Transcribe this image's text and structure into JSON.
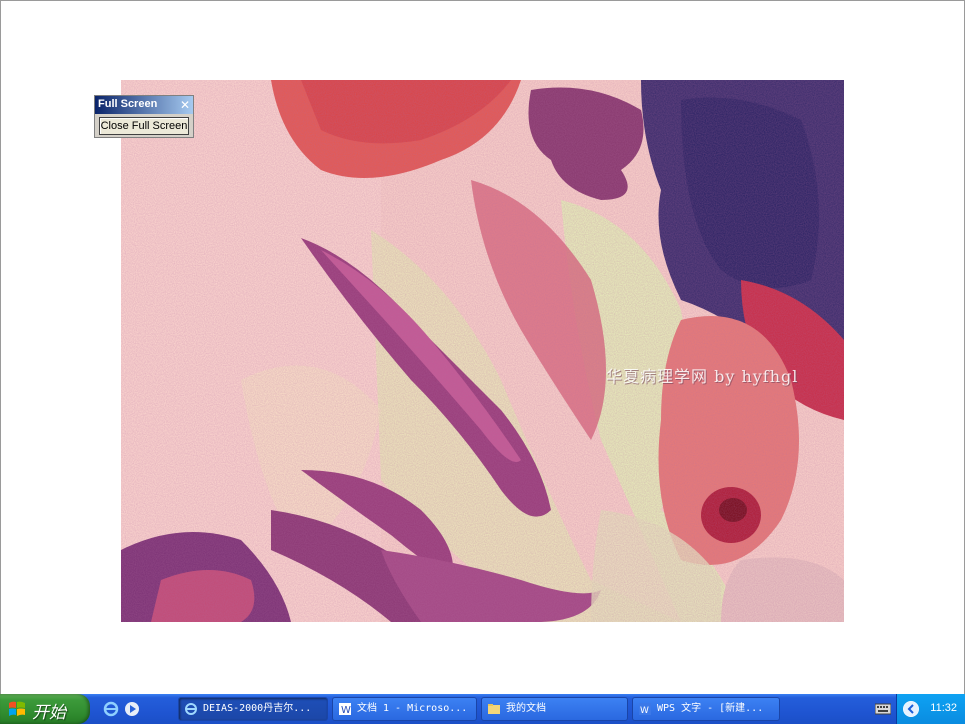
{
  "window": {
    "watermark": "华夏病理学网 by hyfhgl"
  },
  "fullscreen_toolbar": {
    "title": "Full Screen",
    "close_glyph": "✕",
    "button_label": "Close Full Screen"
  },
  "taskbar": {
    "start_label": "开始",
    "quick_launch": [
      {
        "icon": "ie-icon"
      },
      {
        "icon": "media-player-icon"
      }
    ],
    "buttons": [
      {
        "label": "DEIAS-2000丹吉尔...",
        "icon": "ie-window-icon",
        "active": true
      },
      {
        "label": "文档 1 - Microso...",
        "icon": "word-document-icon",
        "active": false
      },
      {
        "label": "我的文档",
        "icon": "folder-icon",
        "active": false
      },
      {
        "label": "WPS 文字 - [新建...",
        "icon": "wps-icon",
        "active": false
      }
    ],
    "clock": "11:32",
    "colors": {
      "taskbar": "#245edb",
      "start": "#3c9a3a",
      "tray": "#0ea2f3"
    }
  }
}
